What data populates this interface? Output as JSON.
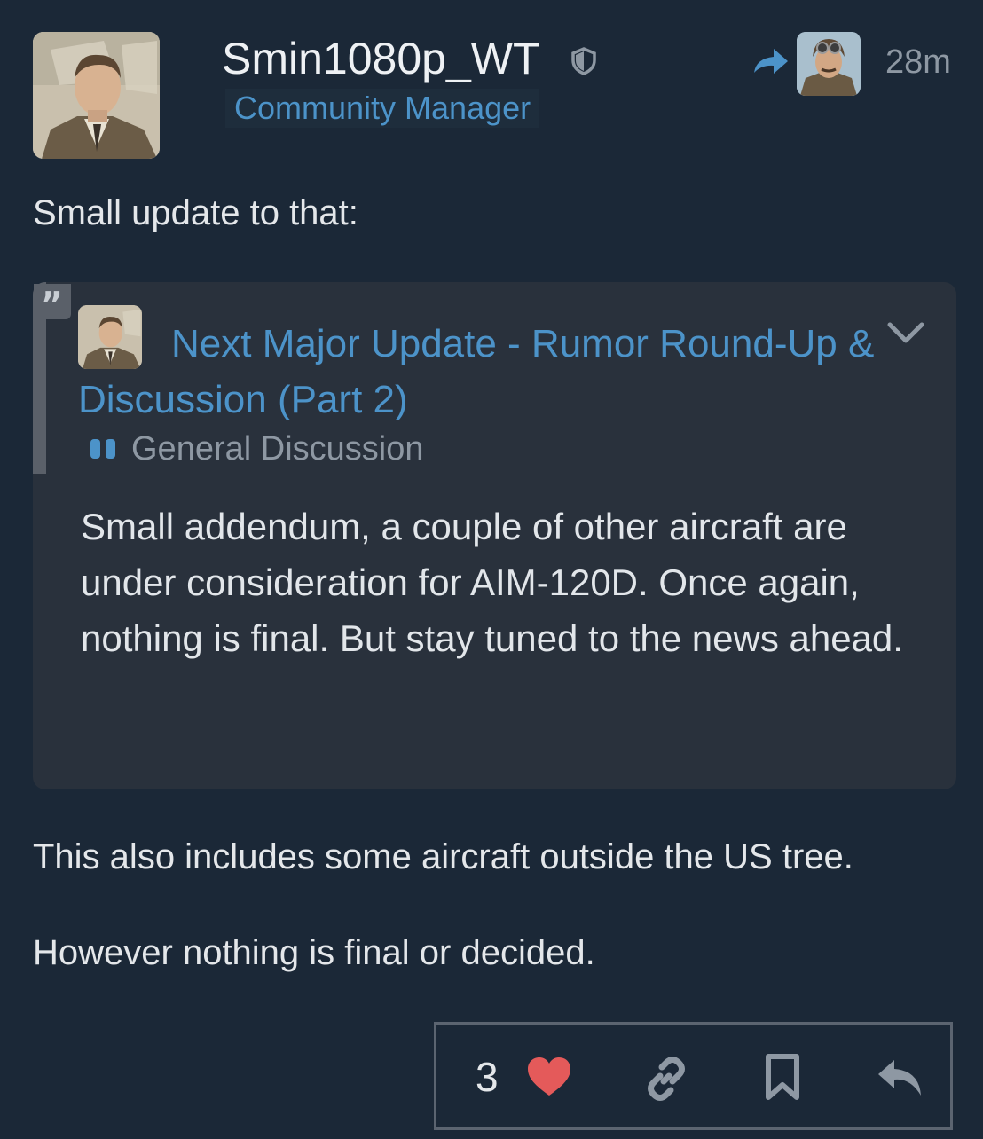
{
  "post": {
    "author": {
      "username": "Smin1080p_WT",
      "title": "Community Manager",
      "avatar_icon": "avatar-portrait-man-suit",
      "badge_icon": "shield-icon"
    },
    "reply_to": {
      "avatar_icon": "avatar-pilot-goggles",
      "arrow_icon": "reply-arrow-icon"
    },
    "timestamp": "28m",
    "paragraphs": {
      "intro": "Small update to that:",
      "after_quote_1": "This also includes some aircraft outside the US tree.",
      "after_quote_2": "However nothing is final or decided."
    },
    "quote": {
      "topic_title": "Next Major Update - Rumor Round-Up & Discussion (Part 2)",
      "category": "General Discussion",
      "category_color": "#4c93c9",
      "text": "Small addendum, a couple of other aircraft are under consideration for AIM-120D. Once again, nothing is final. But stay tuned to the news ahead."
    },
    "actions": {
      "like_count": "3",
      "like_color": "#e45a5a",
      "icons": [
        "heart-icon",
        "link-icon",
        "bookmark-icon",
        "reply-icon"
      ]
    }
  },
  "colors": {
    "background": "#1b2837",
    "accent": "#4c93c9",
    "quote_background": "#29313c",
    "muted_text": "#8e98a3"
  }
}
